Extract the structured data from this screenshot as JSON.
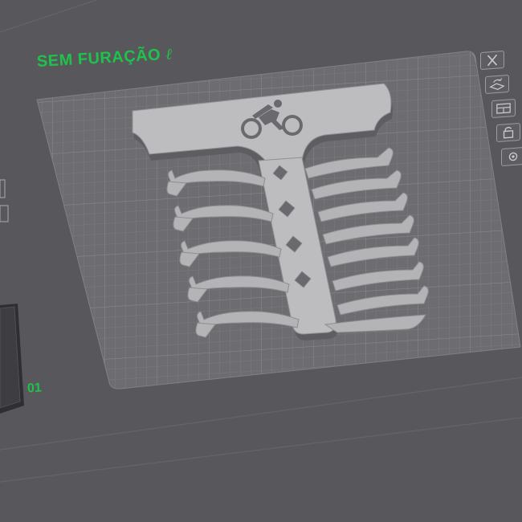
{
  "plate": {
    "title": "SEM FURAÇÃO",
    "edit_glyph": "ℓ",
    "neighbor_number": "01"
  },
  "toolbar": {
    "icons": [
      "close-icon",
      "auto-orient-icon",
      "arrange-icon",
      "lock-icon",
      "settings-icon"
    ]
  },
  "colors": {
    "background": "#58585c",
    "plate": "#6c6c71",
    "grid": "#7d7d82",
    "model": "#a3a3a6",
    "accent": "#1fc24a"
  }
}
